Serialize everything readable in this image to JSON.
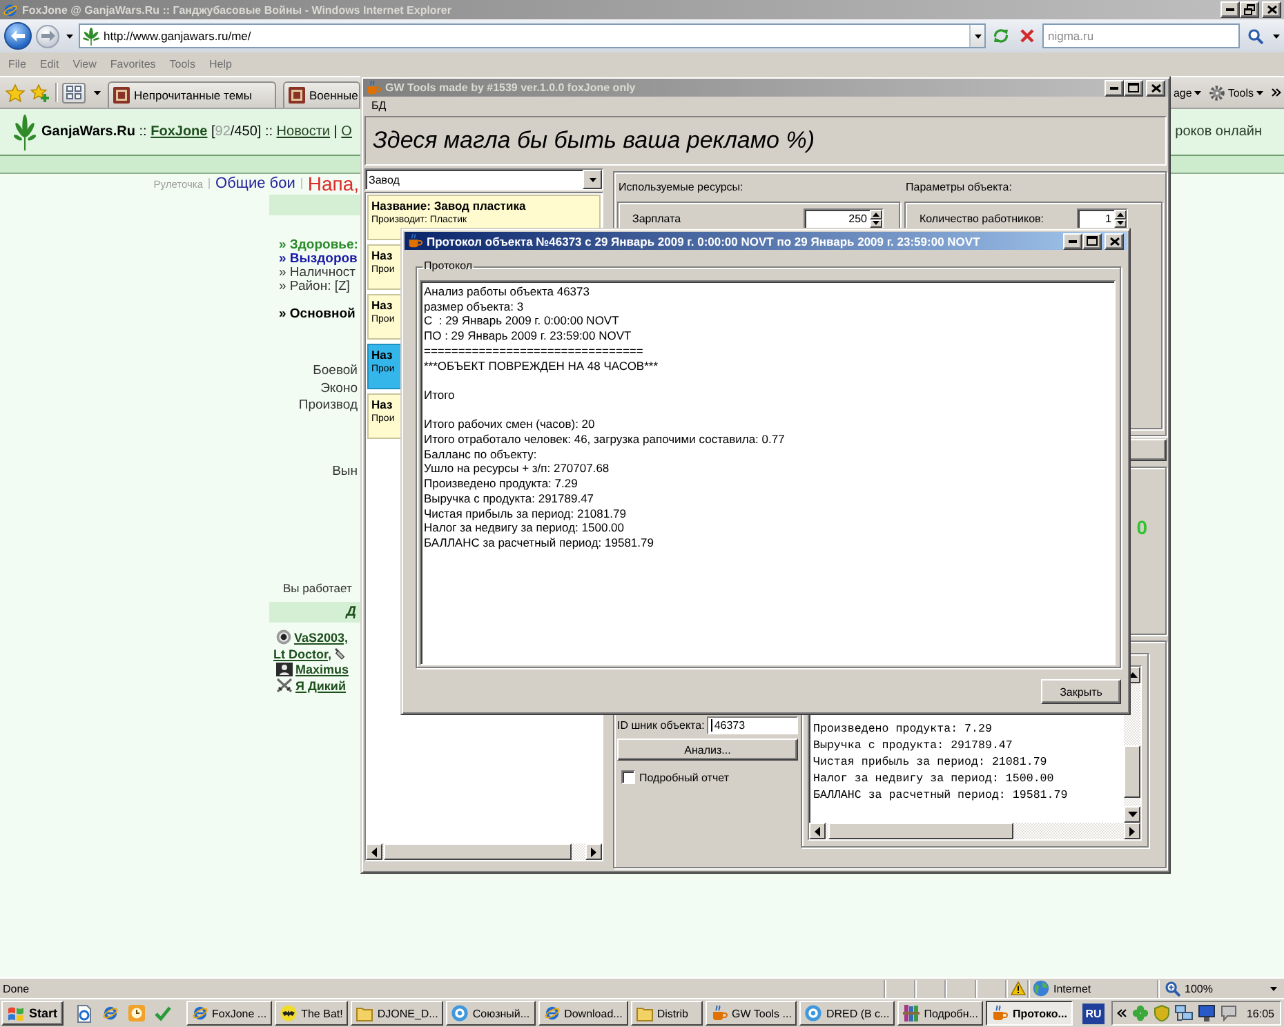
{
  "browser": {
    "title": "FoxJone @ GanjaWars.Ru :: Ганджубасовые Войны - Windows Internet Explorer",
    "active": false,
    "back_disabled": false,
    "forward_disabled": true,
    "address": "http://www.ganjawars.ru/me/",
    "search": {
      "placeholder": "nigma.ru"
    },
    "menu": [
      "File",
      "Edit",
      "View",
      "Favorites",
      "Tools",
      "Help"
    ],
    "tabs": [
      {
        "label": "Непрочитанные темы",
        "selected": false
      },
      {
        "label": "Военные",
        "selected": false
      }
    ],
    "command_bar": [
      {
        "label": "age",
        "kind": "menu"
      },
      {
        "label": "Tools",
        "kind": "tools"
      }
    ],
    "status_bar": {
      "text": "Done",
      "zone": "Internet",
      "zoom": "100%"
    }
  },
  "page": {
    "header": [
      {
        "kind": "brand",
        "text": "GanjaWars.Ru"
      },
      {
        "kind": "plain",
        "text": " :: "
      },
      {
        "kind": "user",
        "text": "FoxJone"
      },
      {
        "kind": "plain",
        "text": " ["
      },
      {
        "kind": "muted",
        "text": "92"
      },
      {
        "kind": "plain",
        "text": "/450] :: "
      },
      {
        "kind": "link",
        "text": "Новости"
      },
      {
        "kind": "plain",
        "text": " | "
      },
      {
        "kind": "link",
        "text": "О"
      }
    ],
    "header_right": "роков онлайн",
    "nav": [
      {
        "kind": "minor",
        "text": "Рулеточка"
      },
      {
        "kind": "link",
        "text": "Общие бои"
      },
      {
        "kind": "alert",
        "text": "Напа,"
      }
    ],
    "stats": [
      {
        "kind": "health",
        "text": "» Здоровье:"
      },
      {
        "kind": "recovery",
        "text": "» Выздоров"
      },
      {
        "kind": "plain",
        "text": "» Наличност"
      },
      {
        "kind": "plain",
        "text": "» Район: [Z]"
      },
      {
        "kind": "main",
        "text": "» Основной"
      }
    ],
    "skills": [
      "Боевой",
      "Эконо",
      "Производ"
    ],
    "extra_label": "Вын",
    "work_note": "Вы работает",
    "friends_title": "Д",
    "friends": [
      {
        "name": "VaS2003,",
        "kind": "dot"
      },
      {
        "name": "Lt Doctor,",
        "kind": "tail"
      },
      {
        "name": "Maximus",
        "kind": "badge"
      },
      {
        "name": "Я Дикий",
        "kind": "swords"
      }
    ]
  },
  "gw_tools": {
    "title": "GW Tools made by #1539 ver.1.0.0 foxJone only",
    "active": false,
    "menu": [
      "БД"
    ],
    "banner": "Здеся магла бы быть ваша рекламо %)",
    "object_type": "Завод",
    "objects": [
      {
        "name": "Название: Завод пластика",
        "detail": "Производит: Пластик",
        "selected": false
      },
      {
        "name": "Наз",
        "detail": "Прои",
        "selected": false
      },
      {
        "name": "Наз",
        "detail": "Прои",
        "selected": false
      },
      {
        "name": "Наз",
        "detail": "Прои",
        "selected": true
      },
      {
        "name": "Наз",
        "detail": "Прои",
        "selected": false
      }
    ],
    "resources": {
      "title": "Используемые ресурсы:",
      "fields": [
        {
          "label": "Зарплата",
          "value": "250"
        }
      ]
    },
    "parameters": {
      "title": "Параметры объекта:",
      "fields": [
        {
          "label": "Количество работников:",
          "value": "1"
        }
      ]
    },
    "result": "0",
    "object_id": {
      "label": "ID шник объекта:",
      "value": "46373"
    },
    "analyze_button": "Анализ...",
    "detailed_report": {
      "label": "Подробный отчет",
      "checked": false
    },
    "report_lines": [
      "Произведено продукта: 7.29",
      "Выручка с продукта: 291789.47",
      "Чистая прибыль за период: 21081.79",
      "Налог за недвигу за период: 1500.00",
      "БАЛЛАНС за расчетный период: 19581.79"
    ]
  },
  "protocol_dialog": {
    "title": "Протокол объекта №46373 с 29 Январь 2009 г. 0:00:00 NOVT по 29 Январь 2009 г. 23:59:00 NOVT",
    "active": true,
    "group": "Протокол",
    "paragraphs": [
      [
        "Анализ работы объекта 46373",
        "размер объекта: 3",
        "С  : 29 Январь 2009 г. 0:00:00 NOVT",
        "ПО : 29 Январь 2009 г. 23:59:00 NOVT",
        "================================",
        "***ОБЪЕКТ ПОВРЕЖДЕН НА 48 ЧАСОВ***"
      ],
      [
        "Итого"
      ],
      [
        "Итого рабочих смен (часов): 20",
        "Итого отработало человек: 46, загрузка рапочими составила: 0.77",
        "Балланс по объекту:",
        "Ушло на ресурсы + з/п: 270707.68",
        "Произведено продукта: 7.29",
        "Выручка с продукта: 291789.47",
        "Чистая прибыль за период: 21081.79",
        "Налог за недвигу за период: 1500.00",
        "БАЛЛАНС за расчетный период: 19581.79"
      ]
    ],
    "close_button": "Закрыть"
  },
  "taskbar": {
    "start": "Start",
    "tasks": [
      {
        "label": "FoxJone ...",
        "kind": "browser",
        "selected": false
      },
      {
        "label": "The Bat!",
        "kind": "mail",
        "selected": false
      },
      {
        "label": "DJONE_D...",
        "kind": "folder",
        "selected": false
      },
      {
        "label": "Союзный...",
        "kind": "messenger",
        "selected": false
      },
      {
        "label": "Download...",
        "kind": "browser",
        "selected": false
      },
      {
        "label": "Distrib",
        "kind": "folder",
        "selected": false
      },
      {
        "label": "GW Tools ...",
        "kind": "java",
        "selected": false
      },
      {
        "label": "DRED (В с...",
        "kind": "messenger",
        "selected": false
      },
      {
        "label": "Подробн...",
        "kind": "archive",
        "selected": false
      },
      {
        "label": "Протоко...",
        "kind": "java",
        "selected": true
      }
    ],
    "language": "RU",
    "clock": "16:05"
  }
}
